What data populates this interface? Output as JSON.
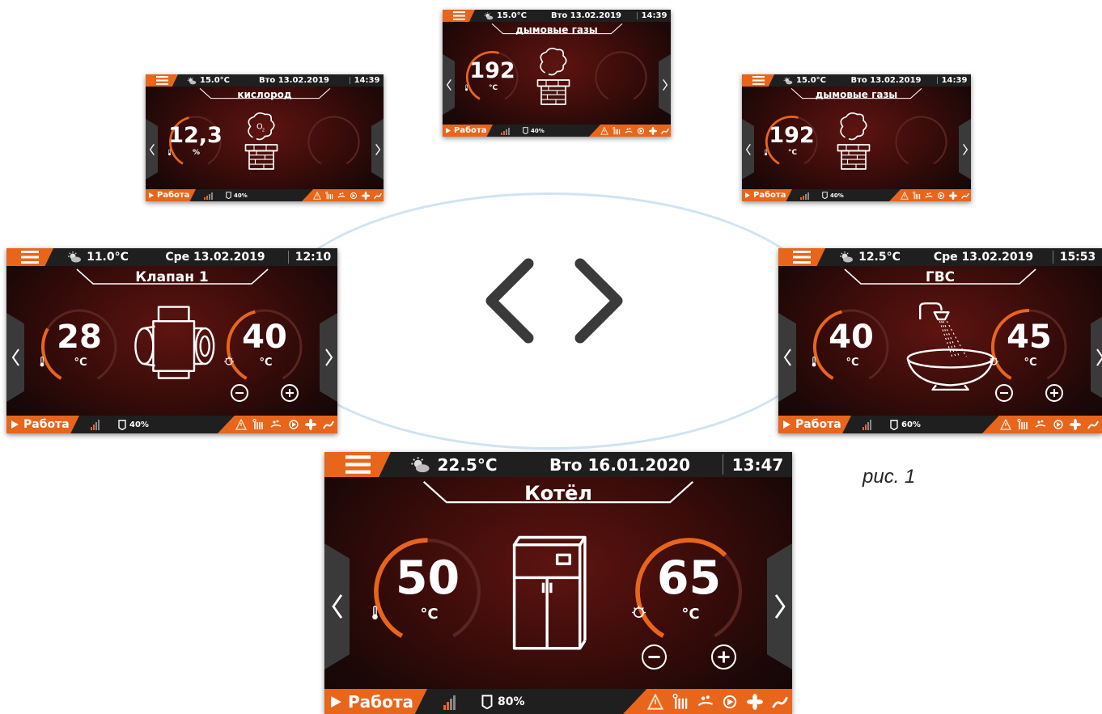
{
  "caption": "рис. 1",
  "colors": {
    "accent": "#e8651c",
    "bar": "#1f1f1f",
    "arc_track": "#5a2420"
  },
  "screens": [
    {
      "id": "kotel",
      "weather": "22.5°C",
      "date": "Вто 16.01.2020",
      "time": "13:47",
      "title": "Котёл",
      "left_value": "50",
      "left_unit": "°C",
      "right_value": "65",
      "right_unit": "°C",
      "left_fill": 0.5,
      "right_fill": 0.65,
      "has_setpoint_controls": true,
      "device_icon": "boiler-icon",
      "status": "Работа",
      "fuel": "80%"
    },
    {
      "id": "klapan",
      "weather": "11.0°C",
      "date": "Сре 13.02.2019",
      "time": "12:10",
      "title": "Клапан 1",
      "left_value": "28",
      "left_unit": "°C",
      "right_value": "40",
      "right_unit": "°C",
      "left_fill": 0.3,
      "right_fill": 0.45,
      "has_setpoint_controls": true,
      "device_icon": "valve-icon",
      "status": "Работа",
      "fuel": "40%"
    },
    {
      "id": "gvs",
      "weather": "12.5°C",
      "date": "Сре 13.02.2019",
      "time": "15:53",
      "title": "ГВС",
      "left_value": "40",
      "left_unit": "°C",
      "right_value": "45",
      "right_unit": "°C",
      "left_fill": 0.45,
      "right_fill": 0.5,
      "has_setpoint_controls": true,
      "device_icon": "bathtub-shower-icon",
      "status": "Работа",
      "fuel": "60%"
    },
    {
      "id": "kislorod",
      "weather": "15.0°C",
      "date": "Вто 13.02.2019",
      "time": "14:39",
      "title": "кислород",
      "left_value": "12,3",
      "left_unit": "%",
      "left_fill": 0.45,
      "device_icon": "chimney-o2-icon",
      "status": "Работа",
      "fuel": "40%"
    },
    {
      "id": "dym1",
      "weather": "15.0°C",
      "date": "Вто 13.02.2019",
      "time": "14:39",
      "title": "дымовые газы",
      "left_value": "192",
      "left_unit": "°C",
      "left_fill": 0.55,
      "device_icon": "chimney-smoke-icon",
      "status": "Работа",
      "fuel": "40%"
    },
    {
      "id": "dym2",
      "weather": "15.0°C",
      "date": "Вто 13.02.2019",
      "time": "14:39",
      "title": "дымовые газы",
      "left_value": "192",
      "left_unit": "°C",
      "left_fill": 0.55,
      "device_icon": "chimney-smoke-icon",
      "status": "Работа",
      "fuel": "40%"
    }
  ],
  "icons": {
    "menu": "hamburger-menu-icon",
    "weather": "sun-cloud-icon",
    "prev": "chevron-left-icon",
    "next": "chevron-right-icon",
    "temp": "thermometer-icon",
    "setpoint": "setpoint-dial-icon",
    "minus": "minus-circle-icon",
    "plus": "plus-circle-icon",
    "play": "play-icon",
    "signal": "signal-bars-icon",
    "fuel": "fuel-level-icon",
    "alarm": "warning-triangle-icon",
    "heating": "radiator-icon",
    "hot_water": "hand-water-icon",
    "pump": "pump-icon",
    "fan": "fan-icon",
    "feeder": "feeder-icon"
  }
}
